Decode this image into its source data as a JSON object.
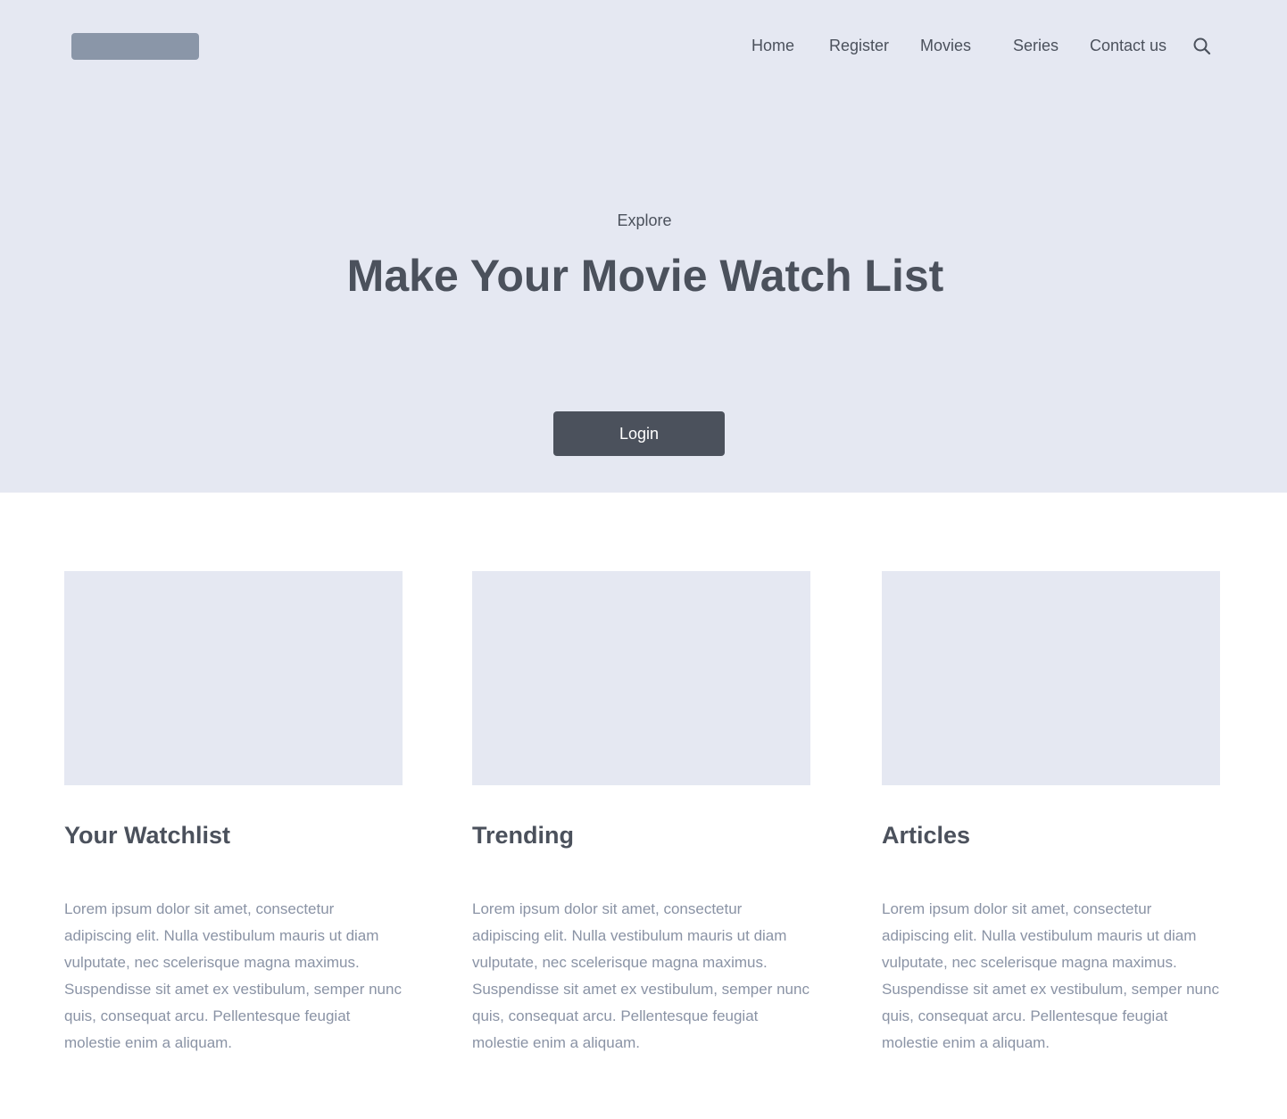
{
  "header": {
    "nav": [
      {
        "label": "Home"
      },
      {
        "label": "Register"
      },
      {
        "label": "Movies"
      },
      {
        "label": "Series"
      },
      {
        "label": "Contact us"
      }
    ],
    "search_icon": "search-icon"
  },
  "hero": {
    "eyebrow": "Explore",
    "title": "Make Your Movie Watch List",
    "login_label": "Login"
  },
  "cards": [
    {
      "title": "Your Watchlist",
      "text": "Lorem ipsum dolor sit amet, consectetur adipiscing elit. Nulla vestibulum mauris ut diam vulputate, nec scelerisque magna maximus. Suspendisse sit amet ex vestibulum, semper nunc quis, consequat arcu. Pellentesque feugiat molestie enim a aliquam."
    },
    {
      "title": "Trending",
      "text": "Lorem ipsum dolor sit amet, consectetur adipiscing elit. Nulla vestibulum mauris ut diam vulputate, nec scelerisque magna maximus. Suspendisse sit amet ex vestibulum, semper nunc quis, consequat arcu. Pellentesque feugiat molestie enim a aliquam."
    },
    {
      "title": "Articles",
      "text": "Lorem ipsum dolor sit amet, consectetur adipiscing elit. Nulla vestibulum mauris ut diam vulputate, nec scelerisque magna maximus. Suspendisse sit amet ex vestibulum, semper nunc quis, consequat arcu. Pellentesque feugiat molestie enim a aliquam."
    }
  ],
  "colors": {
    "hero_background": "#e5e8f2",
    "logo_placeholder": "#8a96a8",
    "text_dark": "#4b515c",
    "text_muted": "#8a93a5",
    "button": "#4b515c"
  }
}
